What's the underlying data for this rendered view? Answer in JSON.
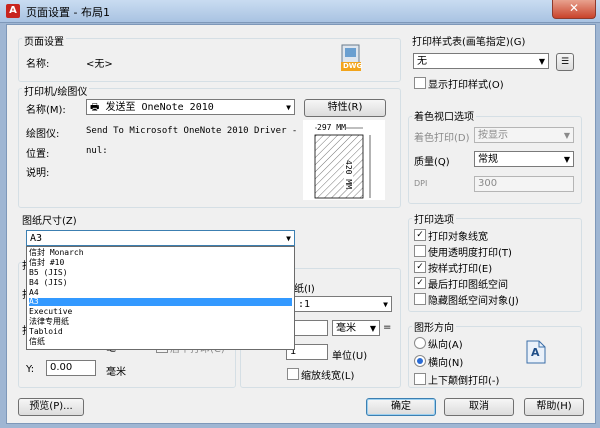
{
  "window": {
    "title": "页面设置 - 布局1",
    "close_icon": "close-icon"
  },
  "page_setup": {
    "group_title": "页面设置",
    "name_label": "名称:",
    "name_value": "<无>",
    "dwg_icon_text": "DWG"
  },
  "printer": {
    "group_title": "打印机/绘图仪",
    "name_label": "名称(M):",
    "name_value": "发送至 OneNote 2010",
    "properties_button": "特性(R)",
    "plotter_label": "绘图仪:",
    "plotter_value": "Send To Microsoft OneNote 2010 Driver - ...",
    "where_label": "位置:",
    "where_value": "nul:",
    "desc_label": "说明:",
    "preview_width": "297 MM",
    "preview_height": "420 MM"
  },
  "paper_size": {
    "group_title": "图纸尺寸(Z)",
    "selected": "A3",
    "options": [
      "信封 Monarch",
      "信封 #10",
      "B5 (JIS)",
      "B4 (JIS)",
      "A4",
      "A3",
      "Executive",
      "法律专用纸",
      "Tabloid",
      "信纸"
    ],
    "selected_index": 5
  },
  "print_area": {
    "partial_label_1": "打",
    "partial_label_2": "打",
    "partial_label_3": "打"
  },
  "offset": {
    "y_label": "Y:",
    "y_value": "0.00",
    "unit": "毫米",
    "partial_unit": "毫",
    "center_partial": "居中打印(C)"
  },
  "scale": {
    "partial_title": "纸(I)",
    "partial_value": ":1",
    "unit": "毫米",
    "eq": "=",
    "units_value": "1",
    "units_label": "单位(U)",
    "scale_lineweights": "缩放线宽(L)"
  },
  "plot_style": {
    "group_title": "打印样式表(画笔指定)(G)",
    "value": "无",
    "display_styles": "显示打印样式(O)"
  },
  "shaded_viewport": {
    "group_title": "着色视口选项",
    "shade_label": "着色打印(D)",
    "shade_value": "按显示",
    "quality_label": "质量(Q)",
    "quality_value": "常规",
    "dpi_label": "DPI",
    "dpi_value": "300"
  },
  "plot_options": {
    "group_title": "打印选项",
    "items": [
      {
        "label": "打印对象线宽",
        "checked": true
      },
      {
        "label": "使用透明度打印(T)",
        "checked": false
      },
      {
        "label": "按样式打印(E)",
        "checked": true
      },
      {
        "label": "最后打印图纸空间",
        "checked": true
      },
      {
        "label": "隐藏图纸空间对象(J)",
        "checked": false
      }
    ]
  },
  "orientation": {
    "group_title": "图形方向",
    "portrait": "纵向(A)",
    "landscape": "横向(N)",
    "upside_down": "上下颠倒打印(-)",
    "icon_letter": "A"
  },
  "footer": {
    "preview": "预览(P)...",
    "ok": "确定",
    "cancel": "取消",
    "help": "帮助(H)"
  }
}
